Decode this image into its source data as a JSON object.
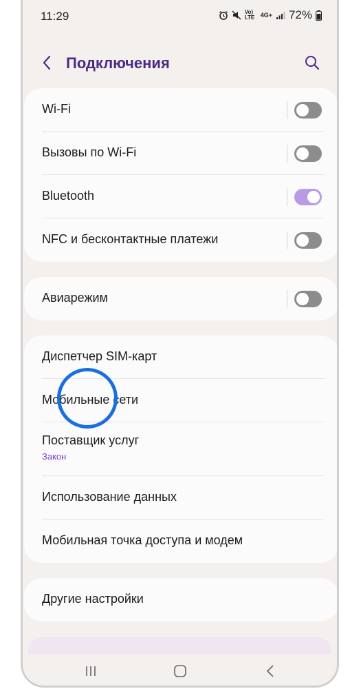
{
  "status_bar": {
    "time": "11:29",
    "battery": "72%",
    "network_4g": "4G+",
    "volte": "Vo) LTE"
  },
  "header": {
    "title": "Подключения"
  },
  "groups": [
    {
      "items": [
        {
          "label": "Wi-Fi",
          "toggle": "off"
        },
        {
          "label": "Вызовы по Wi-Fi",
          "toggle": "off"
        },
        {
          "label": "Bluetooth",
          "toggle": "on"
        },
        {
          "label": "NFC и бесконтактные платежи",
          "toggle": "off"
        }
      ]
    },
    {
      "items": [
        {
          "label": "Авиарежим",
          "toggle": "off"
        }
      ]
    },
    {
      "items": [
        {
          "label": "Диспетчер SIM-карт"
        },
        {
          "label": "Мобильные сети"
        },
        {
          "label": "Поставщик услуг",
          "sublabel": "Закон"
        },
        {
          "label": "Использование данных"
        },
        {
          "label": "Мобильная точка доступа и модем"
        }
      ]
    },
    {
      "items": [
        {
          "label": "Другие настройки"
        }
      ]
    }
  ],
  "colors": {
    "accent": "#4b2a86",
    "toggle_on": "#b99ae6",
    "toggle_off": "#8c8c8c",
    "sublabel": "#7a3fd1",
    "touch_indicator": "#1a6fe0"
  },
  "icons": {
    "back": "chevron-left-icon",
    "search": "search-icon",
    "recents": "recents-icon",
    "home": "home-icon",
    "nav_back": "back-icon"
  }
}
